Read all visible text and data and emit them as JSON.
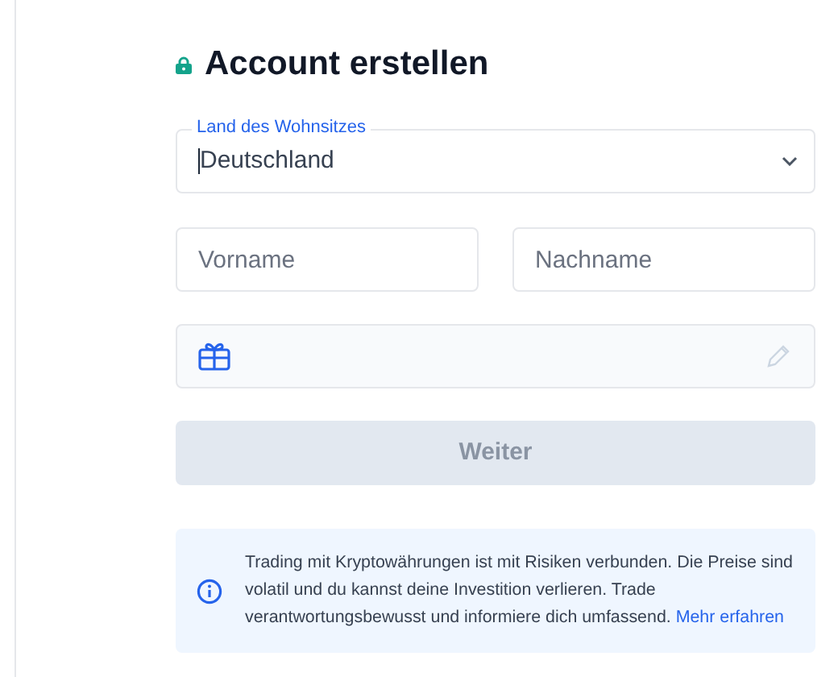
{
  "title": "Account erstellen",
  "country": {
    "label": "Land des Wohnsitzes",
    "value": "Deutschland"
  },
  "first_name": {
    "placeholder": "Vorname"
  },
  "last_name": {
    "placeholder": "Nachname"
  },
  "button": {
    "label": "Weiter",
    "disabled": true
  },
  "notice": {
    "text": "Trading mit Kryptowährungen ist mit Risiken verbunden. Die Preise sind volatil und du kannst deine Investition verlieren. Trade verantwortungsbewusst und informiere dich umfassend.",
    "link": "Mehr erfahren"
  }
}
